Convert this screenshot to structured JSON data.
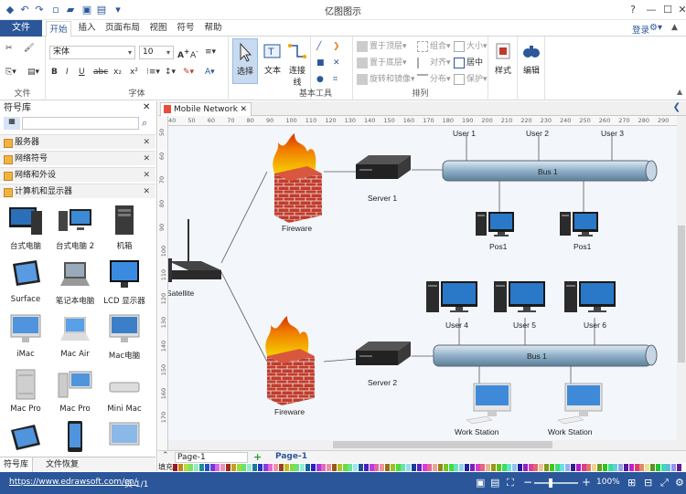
{
  "app": {
    "title": "亿图图示"
  },
  "window_controls": {
    "help": "?",
    "minimize": "—",
    "maximize": "☐",
    "close": "✕"
  },
  "menu": {
    "file": "文件",
    "tabs": [
      "开始",
      "插入",
      "页面布局",
      "视图",
      "符号",
      "帮助"
    ],
    "login": "登录"
  },
  "ribbon": {
    "groups": {
      "file": "文件",
      "font": "字体",
      "tools": "基本工具",
      "arrange": "排列",
      "style": "样式",
      "edit": "编辑"
    },
    "font_name": "宋体",
    "font_size": "10",
    "tools": {
      "select": "选择",
      "text": "文本",
      "connector": "连接线"
    },
    "arrange": {
      "bring_front": "置于顶层",
      "send_back": "置于底层",
      "rotate": "旋转和镜像",
      "group": "组合",
      "align": "对齐",
      "distribute": "分布",
      "size": "大小",
      "center": "居中",
      "protect": "保护"
    },
    "style_label": "样式",
    "edit_label": "编辑"
  },
  "library": {
    "title": "符号库",
    "categories": [
      "服务器",
      "网络符号",
      "网络和外设",
      "计算机和显示器"
    ],
    "shapes": [
      "台式电脑",
      "台式电脑 2",
      "机箱",
      "Surface",
      "笔记本电脑",
      "LCD 显示器",
      "iMac",
      "Mac Air",
      "Mac电脑",
      "Mac Pro",
      "Mac Pro",
      "Mini Mac"
    ],
    "bottom_tabs": [
      "符号库",
      "文件恢复"
    ]
  },
  "document": {
    "tab": "Mobile Network"
  },
  "ruler": {
    "h": [
      "40",
      "50",
      "60",
      "70",
      "80",
      "90",
      "100",
      "110",
      "120",
      "130",
      "140",
      "150",
      "160",
      "170",
      "180",
      "190",
      "200",
      "210",
      "220",
      "230",
      "240",
      "250",
      "260",
      "270",
      "280",
      "290"
    ],
    "v": [
      "50",
      "60",
      "70",
      "80",
      "90",
      "100",
      "110",
      "120",
      "130",
      "140",
      "150",
      "160",
      "170"
    ]
  },
  "diagram": {
    "satellite": "Satellite",
    "firewall_top": "Fireware",
    "firewall_bottom": "Fireware",
    "server1": "Server 1",
    "server2": "Server 2",
    "bus1": "Bus 1",
    "bus2": "Bus 1",
    "user1": "User 1",
    "user2": "User 2",
    "user3": "User 3",
    "pos1a": "Pos1",
    "pos1b": "Pos1",
    "user4": "User 4",
    "user5": "User 5",
    "user6": "User 6",
    "ws1": "Work Station",
    "ws2": "Work Station"
  },
  "pages": {
    "current": "Page-1",
    "tab": "Page-1",
    "fill_label": "填充"
  },
  "status": {
    "url": "https://www.edrawsoft.com/cn/",
    "page": "页 1/1",
    "zoom": "100%"
  },
  "colors": {
    "accent": "#2b579a",
    "bus": "#8fb0c8",
    "brick": "#c23b2b"
  }
}
